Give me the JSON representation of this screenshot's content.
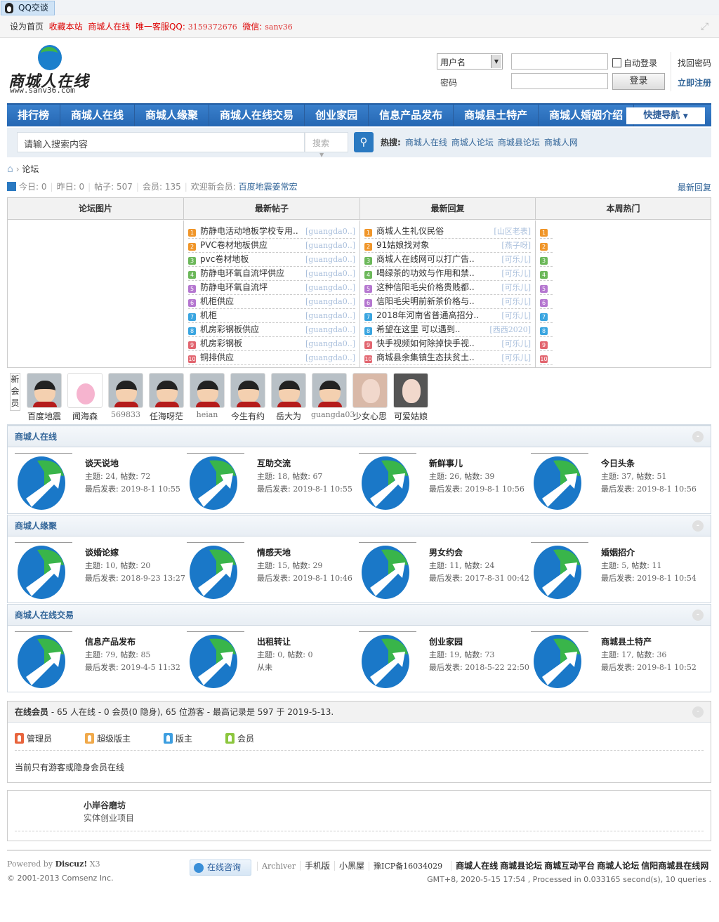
{
  "topbar": {
    "qq_label": "QQ交谈"
  },
  "toolbar": {
    "set_home": "设为首页",
    "bookmark": "收藏本站",
    "site": "商城人在线",
    "service_label": "唯一客服QQ:",
    "qq_number": "3159372676",
    "wechat_label": "微信:",
    "wechat": "sanv36"
  },
  "logo": {
    "title": "商城人在线",
    "url": "www.sanv36.com"
  },
  "login": {
    "user_select": "用户名",
    "password_label": "密码",
    "auto_login": "自动登录",
    "login_button": "登录",
    "forgot": "找回密码",
    "register": "立即注册"
  },
  "nav": {
    "items": [
      "排行榜",
      "商城人在线",
      "商城人缘聚",
      "商城人在线交易",
      "创业家园",
      "信息产品发布",
      "商城县土特产",
      "商城人婚姻介绍"
    ],
    "quick": "快捷导航"
  },
  "search": {
    "placeholder": "请输入搜索内容",
    "type": "搜索",
    "hot_label": "热搜:",
    "hot": [
      "商城人在线",
      "商城人论坛",
      "商城县论坛",
      "商城人网"
    ]
  },
  "breadcrumb": {
    "current": "论坛"
  },
  "stats": {
    "today_label": "今日:",
    "today": "0",
    "yesterday_label": "昨日:",
    "yesterday": "0",
    "posts_label": "帖子:",
    "posts": "507",
    "members_label": "会员:",
    "members": "135",
    "welcome_label": "欢迎新会员:",
    "newest": "百度地震姜常宏",
    "latest_reply": "最新回复"
  },
  "portal": {
    "headers": [
      "论坛图片",
      "最新帖子",
      "最新回复",
      "本周热门"
    ],
    "new_threads": [
      {
        "title": "防静电活动地板学校专用..",
        "author": "[guangda0..]"
      },
      {
        "title": "PVC卷材地板供应",
        "author": "[guangda0..]"
      },
      {
        "title": "pvc卷材地板",
        "author": "[guangda0..]"
      },
      {
        "title": "防静电环氧自流坪供应",
        "author": "[guangda0..]"
      },
      {
        "title": "防静电环氧自流坪",
        "author": "[guangda0..]"
      },
      {
        "title": "机柜供应",
        "author": "[guangda0..]"
      },
      {
        "title": "机柜",
        "author": "[guangda0..]"
      },
      {
        "title": "机房彩钢板供应",
        "author": "[guangda0..]"
      },
      {
        "title": "机房彩钢板",
        "author": "[guangda0..]"
      },
      {
        "title": "铜排供应",
        "author": "[guangda0..]"
      }
    ],
    "new_replies": [
      {
        "title": "商城人生礼仪民俗",
        "author": "[山区老表]"
      },
      {
        "title": "91姑娘找对象",
        "author": "[燕子呀]"
      },
      {
        "title": "商城人在线网可以打广告..",
        "author": "[可乐儿]"
      },
      {
        "title": "喝绿茶的功效与作用和禁..",
        "author": "[可乐儿]"
      },
      {
        "title": "这种信阳毛尖价格贵贱都..",
        "author": "[可乐儿]"
      },
      {
        "title": "信阳毛尖明前新茶价格与..",
        "author": "[可乐儿]"
      },
      {
        "title": "2018年河南省普通高招分..",
        "author": "[可乐儿]"
      },
      {
        "title": "希望在这里 可以遇到..",
        "author": "[西西2020]"
      },
      {
        "title": "快手视频如何除掉快手视..",
        "author": "[可乐儿]"
      },
      {
        "title": "商城县余集镇生态扶贫土..",
        "author": "[可乐儿]"
      }
    ],
    "badge_colors": [
      "#f0962a",
      "#f0962a",
      "#6cb85a",
      "#6cb85a",
      "#b577d0",
      "#b577d0",
      "#3aa5e0",
      "#3aa5e0",
      "#e26670",
      "#e26670"
    ]
  },
  "new_members": {
    "label": "新会员",
    "items": [
      "百度地震",
      "闻海森",
      "569833",
      "任海呀茫",
      "heian",
      "今生有约",
      "岳大为",
      "guangda03",
      "少女心思",
      "可爱姑娘"
    ]
  },
  "categories": [
    {
      "name": "商城人在线",
      "forums": [
        {
          "name": "谈天说地",
          "threads": "24",
          "posts": "72",
          "last": "2019-8-1 10:55"
        },
        {
          "name": "互助交流",
          "threads": "18",
          "posts": "67",
          "last": "2019-8-1 10:55"
        },
        {
          "name": "新鲜事儿",
          "threads": "26",
          "posts": "39",
          "last": "2019-8-1 10:56"
        },
        {
          "name": "今日头条",
          "threads": "37",
          "posts": "51",
          "last": "2019-8-1 10:56"
        }
      ]
    },
    {
      "name": "商城人缘聚",
      "forums": [
        {
          "name": "谈婚论嫁",
          "threads": "10",
          "posts": "20",
          "last": "2018-9-23 13:27"
        },
        {
          "name": "情感天地",
          "threads": "15",
          "posts": "29",
          "last": "2019-8-1 10:46"
        },
        {
          "name": "男女约会",
          "threads": "11",
          "posts": "24",
          "last": "2017-8-31 00:42"
        },
        {
          "name": "婚姻招介",
          "threads": "5",
          "posts": "11",
          "last": "2019-8-1 10:54"
        }
      ]
    },
    {
      "name": "商城人在线交易",
      "forums": [
        {
          "name": "信息产品发布",
          "threads": "79",
          "posts": "85",
          "last": "2019-4-5 11:32"
        },
        {
          "name": "出租转让",
          "threads": "0",
          "posts": "0",
          "last": "从未"
        },
        {
          "name": "创业家园",
          "threads": "19",
          "posts": "73",
          "last": "2018-5-22 22:50"
        },
        {
          "name": "商城县土特产",
          "threads": "17",
          "posts": "36",
          "last": "2019-8-1 10:52"
        }
      ]
    }
  ],
  "forum_labels": {
    "threads": "主题:",
    "posts": "帖数:",
    "last": "最后发表:"
  },
  "online": {
    "title": "在线会员",
    "summary": " - 65 人在线 - 0 会员(0 隐身), 65 位游客 - 最高记录是 597 于 2019-5-13.",
    "legend": [
      "管理员",
      "超级版主",
      "版主",
      "会员"
    ],
    "legend_colors": [
      "#e8643c",
      "#f0a94a",
      "#3d9ee0",
      "#8cc63e"
    ],
    "note": "当前只有游客或隐身会员在线"
  },
  "ad": {
    "title": "小岸谷磨坊",
    "subtitle": "实体创业项目"
  },
  "footer": {
    "powered": "Powered by",
    "discuz": "Discuz!",
    "version": "X3",
    "copyright": "© 2001-2013 Comsenz Inc.",
    "consult": "在线咨询",
    "links": [
      "Archiver",
      "手机版",
      "小黑屋",
      "豫ICP备16034029"
    ],
    "site_links": [
      "商城人在线",
      "商城县论坛",
      "商城互动平台",
      "商城人论坛",
      "信阳商城县在线网"
    ],
    "stats": "GMT+8, 2020-5-15 17:54 , Processed in 0.033165 second(s), 10 queries ."
  }
}
